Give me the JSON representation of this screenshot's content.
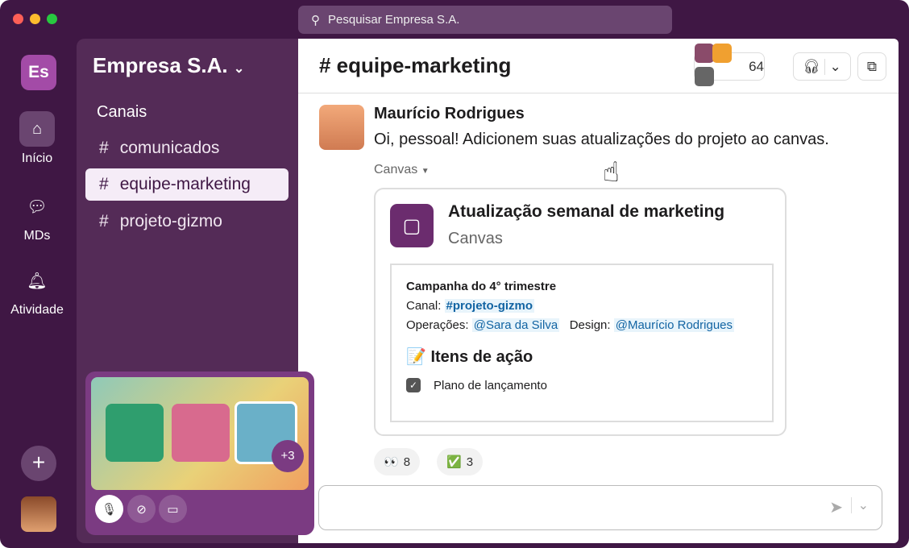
{
  "search": {
    "placeholder": "Pesquisar Empresa S.A."
  },
  "rail": {
    "workspace_initials": "Es",
    "items": [
      {
        "label": "Início"
      },
      {
        "label": "MDs"
      },
      {
        "label": "Atividade"
      }
    ]
  },
  "sidebar": {
    "workspace": "Empresa S.A.",
    "section": "Canais",
    "channels": [
      {
        "name": "comunicados"
      },
      {
        "name": "equipe-marketing"
      },
      {
        "name": "projeto-gizmo"
      }
    ]
  },
  "header": {
    "channel": "# equipe-marketing",
    "member_count": "64"
  },
  "message": {
    "author": "Maurício Rodrigues",
    "text": "Oi, pessoal! Adicionem suas atualizações do projeto ao canvas.",
    "attachment_label": "Canvas"
  },
  "canvas": {
    "title": "Atualização semanal de marketing",
    "type": "Canvas",
    "heading": "Campanha do 4° trimestre",
    "channel_label": "Canal:",
    "channel_link": "#projeto-gizmo",
    "ops_label": "Operações:",
    "ops_mention": "@Sara da Silva",
    "design_label": "Design:",
    "design_mention": "@Maurício Rodrigues",
    "actions_title": "Itens de ação",
    "actions": [
      {
        "label": "Plano de lançamento",
        "checked": true
      }
    ]
  },
  "reactions": [
    {
      "emoji": "👀",
      "count": "8"
    },
    {
      "emoji": "✅",
      "count": "3"
    }
  ],
  "huddle": {
    "extra_count": "+3"
  }
}
